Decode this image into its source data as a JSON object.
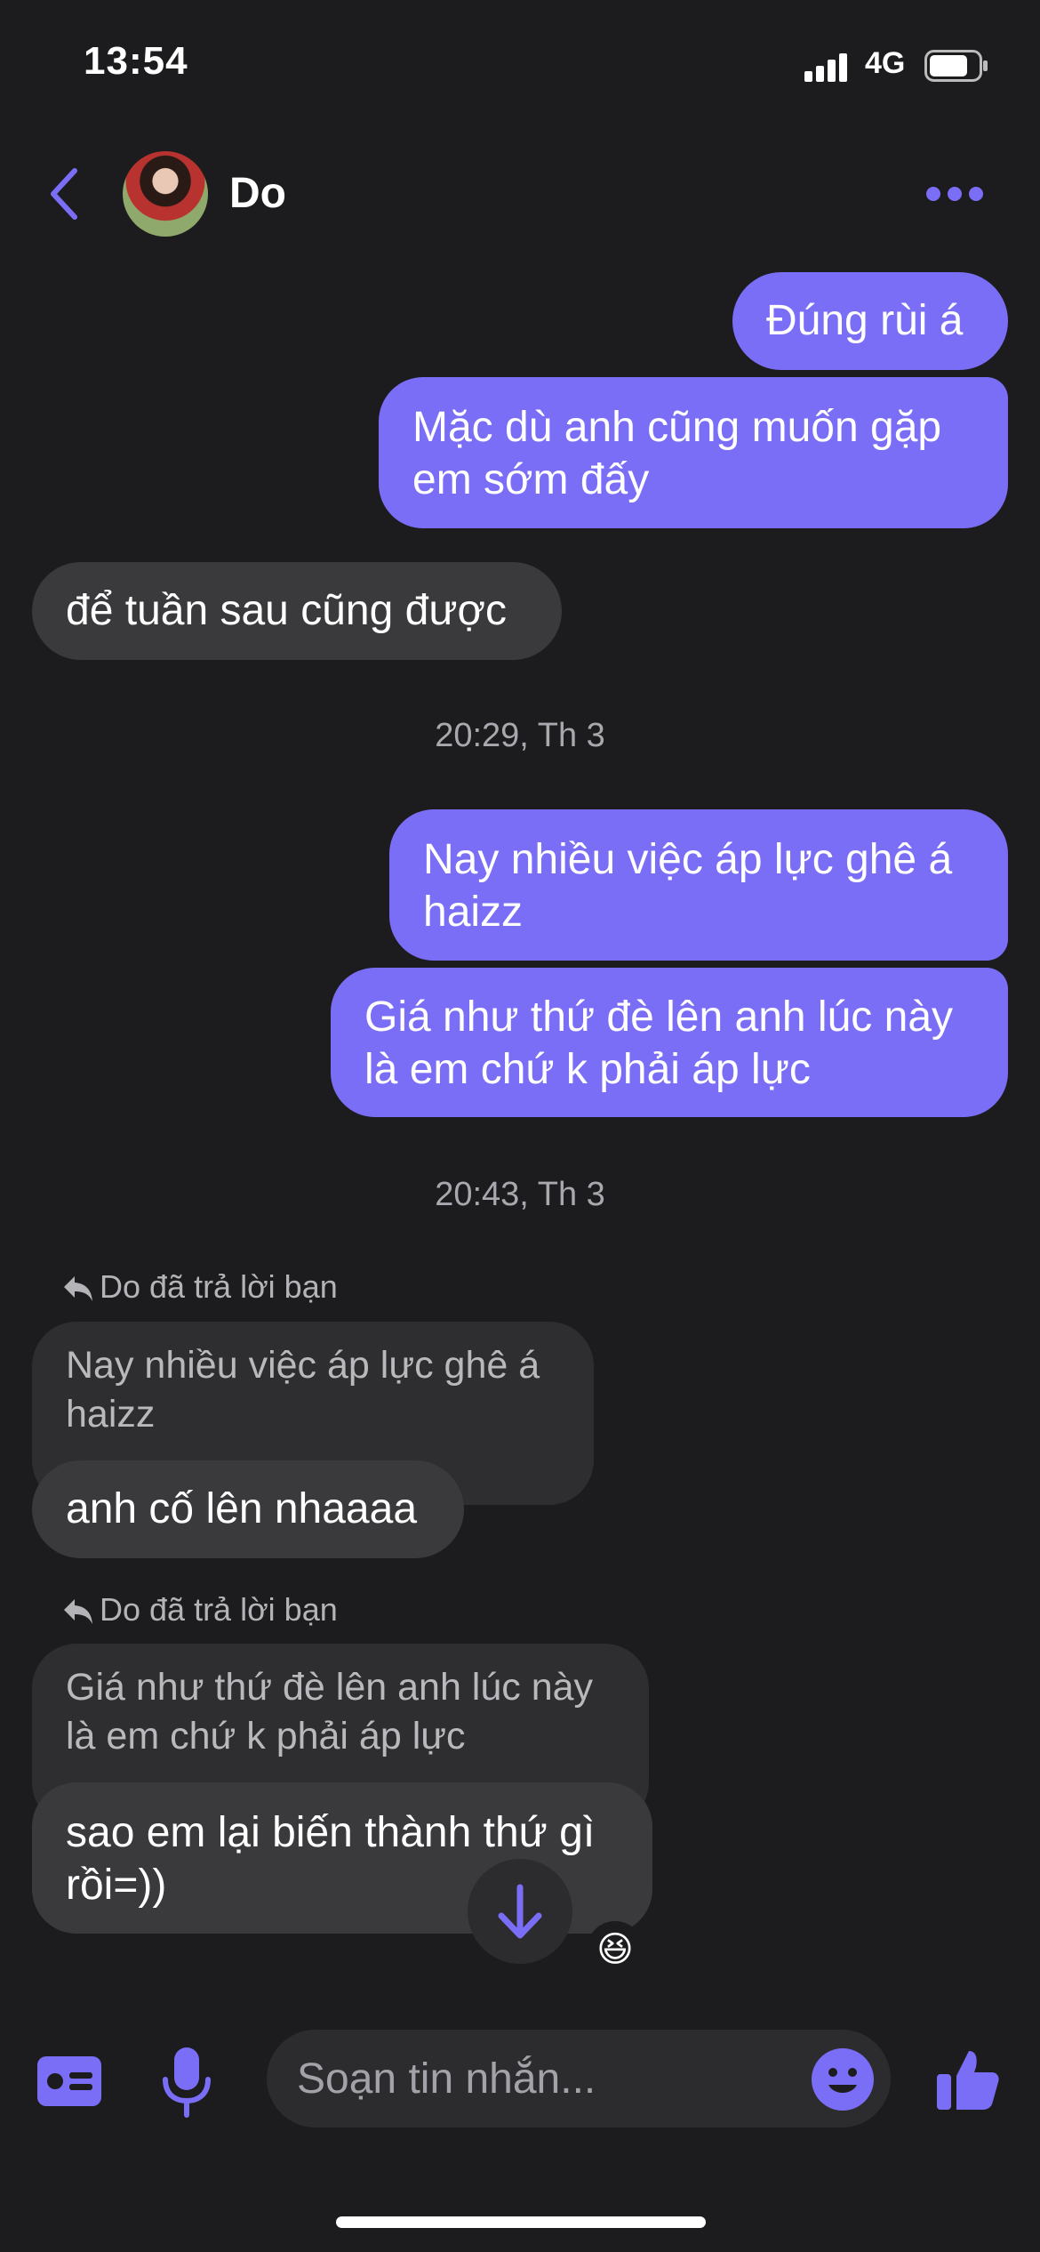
{
  "status": {
    "time": "13:54",
    "network": "4G"
  },
  "header": {
    "contact_name": "Do"
  },
  "messages": {
    "m1": "Đúng rùi á",
    "m2": "Mặc dù anh cũng muốn gặp\nem sớm đấy",
    "m3": "để tuần sau cũng được",
    "ts1": "20:29, Th 3",
    "m4": "Nay nhiều việc áp lực ghê á\nhaizz",
    "m5": "Giá như thứ đè lên anh lúc này\nlà em chứ k phải áp lực",
    "ts2": "20:43, Th 3",
    "reply_label": "Do đã trả lời bạn",
    "q1": "Nay nhiều việc áp lực ghê á\nhaizz",
    "m6": "anh cố lên nhaaaa",
    "reply_label2": "Do đã trả lời bạn",
    "q2": "Giá như thứ đè lên anh lúc này\nlà em chứ k phải áp lực",
    "m7": "sao em lại biến thành thứ gì\nrồi=))",
    "reaction": "😆"
  },
  "composer": {
    "placeholder": "Soạn tin nhắn..."
  },
  "colors": {
    "accent": "#7b6ef6",
    "background": "#1c1c1e",
    "incoming": "#3a3a3c"
  }
}
